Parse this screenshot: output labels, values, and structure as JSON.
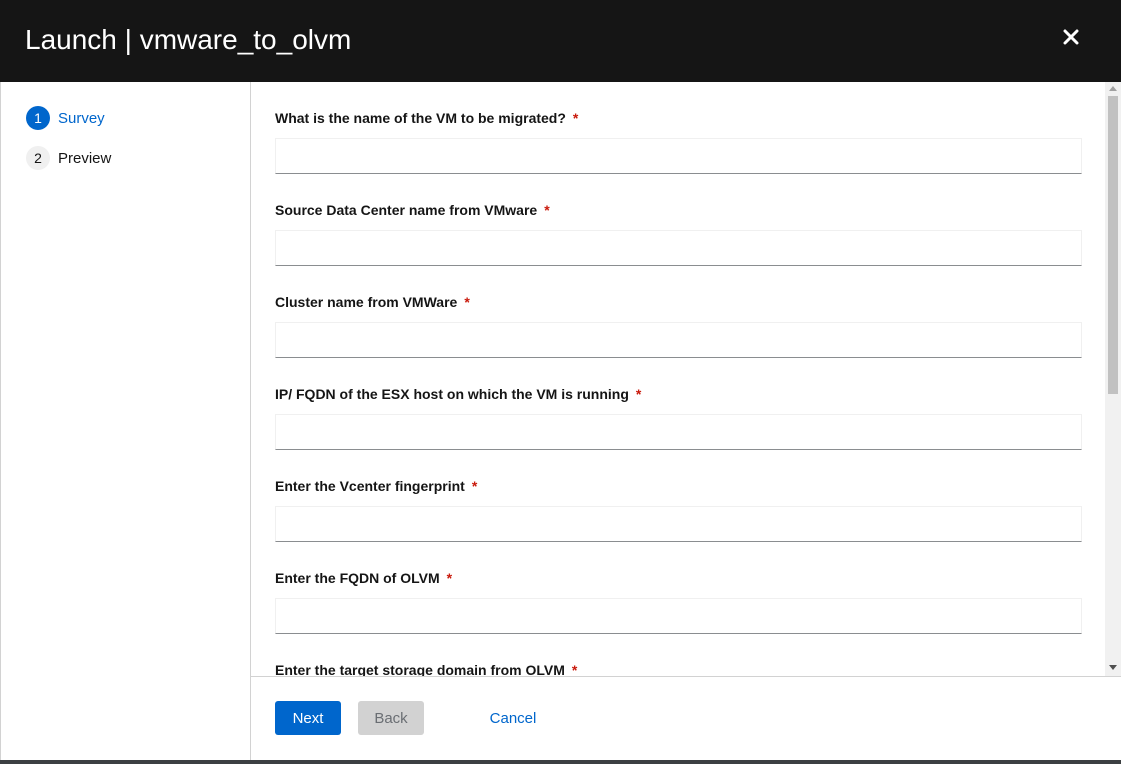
{
  "modal": {
    "title": "Launch | vmware_to_olvm"
  },
  "nav": {
    "items": [
      {
        "number": "1",
        "label": "Survey"
      },
      {
        "number": "2",
        "label": "Preview"
      }
    ]
  },
  "survey": {
    "fields": [
      {
        "label": "What is the name of the VM to be migrated?",
        "required": "*",
        "value": ""
      },
      {
        "label": "Source Data Center name from VMware",
        "required": "*",
        "value": ""
      },
      {
        "label": "Cluster name from VMWare",
        "required": "*",
        "value": ""
      },
      {
        "label": "IP/ FQDN of the ESX host on which the VM is running",
        "required": "*",
        "value": ""
      },
      {
        "label": "Enter the Vcenter fingerprint",
        "required": "*",
        "value": ""
      },
      {
        "label": "Enter the FQDN of OLVM",
        "required": "*",
        "value": ""
      },
      {
        "label": "Enter the target storage domain from OLVM",
        "required": "*",
        "value": ""
      }
    ]
  },
  "footer": {
    "next_label": "Next",
    "back_label": "Back",
    "cancel_label": "Cancel"
  },
  "colors": {
    "header_bg": "#151515",
    "primary": "#0066cc",
    "required": "#c9190b",
    "disabled_bg": "#d2d2d2"
  },
  "icons": {
    "close": "close-icon"
  }
}
